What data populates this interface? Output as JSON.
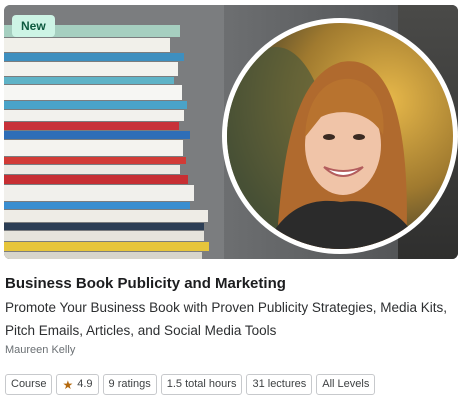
{
  "badge": "New",
  "course": {
    "title": "Business Book Publicity and Marketing",
    "subtitle": "Promote Your Business Book with Proven Publicity Strategies, Media Kits, Pitch Emails, Articles, and Social Media Tools",
    "instructor": "Maureen Kelly"
  },
  "tags": {
    "type": "Course",
    "rating": "4.9",
    "ratings_count": "9 ratings",
    "hours": "1.5 total hours",
    "lectures": "31 lectures",
    "level": "All Levels"
  },
  "icons": {
    "star": "star-icon"
  },
  "colors": {
    "badge_bg": "#cdf4e5",
    "badge_text": "#0d5a3f",
    "star": "#b4690e"
  }
}
